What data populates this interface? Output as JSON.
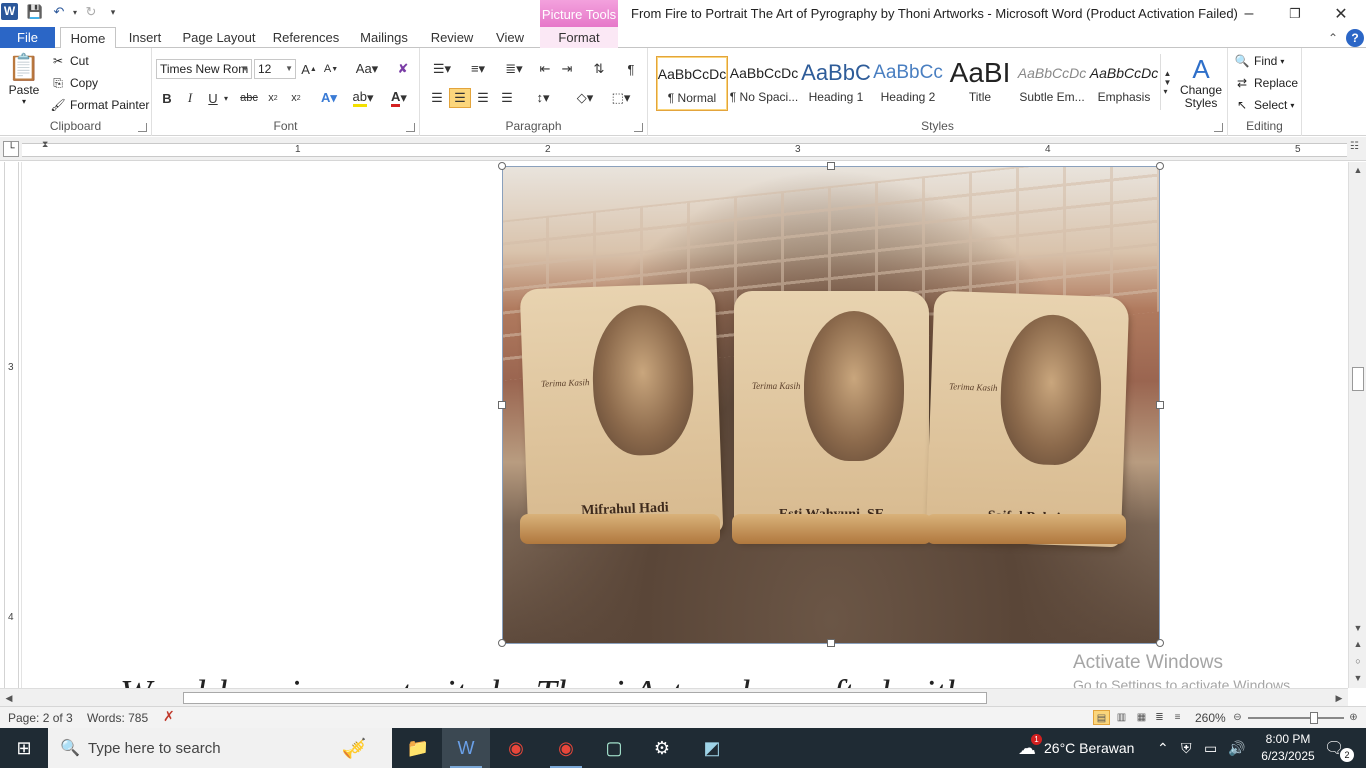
{
  "titlebar": {
    "logo": "W",
    "context_tab_header": "Picture Tools",
    "title": "From Fire to Portrait The Art of Pyrography by Thoni Artworks  -  Microsoft Word (Product Activation Failed)",
    "icons": [
      "save-icon",
      "undo-icon",
      "redo-icon",
      "customize-qat-icon"
    ]
  },
  "tabs": {
    "file": "File",
    "home": "Home",
    "insert": "Insert",
    "page_layout": "Page Layout",
    "references": "References",
    "mailings": "Mailings",
    "review": "Review",
    "view": "View",
    "format": "Format"
  },
  "clipboard": {
    "paste": "Paste",
    "cut": "Cut",
    "copy": "Copy",
    "format_painter": "Format Painter",
    "label": "Clipboard"
  },
  "font": {
    "name": "Times New Rom",
    "size": "12",
    "label": "Font"
  },
  "paragraph": {
    "label": "Paragraph"
  },
  "styles": {
    "items": [
      {
        "sample": "AaBbCcDc",
        "name": "¶ Normal"
      },
      {
        "sample": "AaBbCcDc",
        "name": "¶ No Spaci..."
      },
      {
        "sample": "AaBbC",
        "name": "Heading 1"
      },
      {
        "sample": "AaBbCc",
        "name": "Heading 2"
      },
      {
        "sample": "AaBI",
        "name": "Title"
      },
      {
        "sample": "AaBbCcDc",
        "name": "Subtle Em..."
      },
      {
        "sample": "AaBbCcDc",
        "name": "Emphasis"
      }
    ],
    "change_styles": "Change Styles",
    "label": "Styles"
  },
  "editing": {
    "find": "Find",
    "replace": "Replace",
    "select": "Select",
    "label": "Editing"
  },
  "ruler": {
    "h_numbers": [
      "1",
      "2",
      "3",
      "4",
      "5"
    ],
    "v_numbers": [
      "3",
      "4"
    ]
  },
  "document": {
    "plaque_captions": [
      "Mifrahul Hadi",
      "Esti Wahyuni, SE",
      "Saiful Bahri"
    ],
    "plaque_note": "Terima Kasih",
    "body_text": "Wood-burning portraits by Thoni Artworks crafted with",
    "watermark_title": "Activate Windows",
    "watermark_sub": "Go to Settings to activate Windows."
  },
  "statusbar": {
    "page": "Page: 2 of 3",
    "words": "Words: 785",
    "zoom": "260%"
  },
  "taskbar": {
    "search_placeholder": "Type here to search",
    "weather": "26°C  Berawan",
    "weather_badge": "1",
    "time": "8:00 PM",
    "date": "6/23/2025",
    "notifications": "2"
  }
}
